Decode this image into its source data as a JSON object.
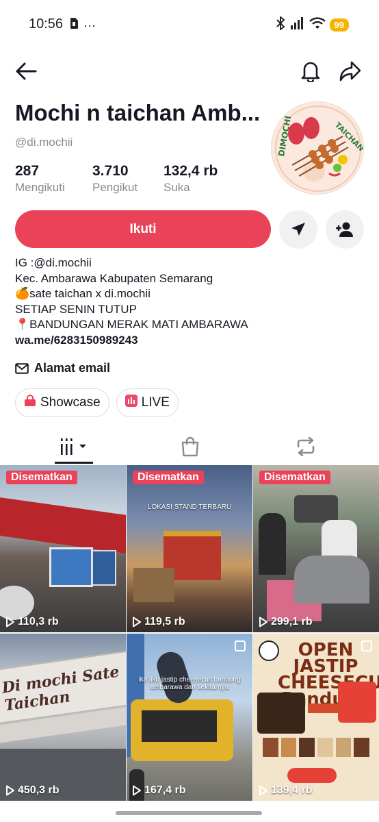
{
  "status_bar": {
    "time": "10:56",
    "battery": "99"
  },
  "profile": {
    "name": "Mochi n taichan Amb...",
    "handle": "@di.mochii",
    "avatar_logo_text": "TAICHAN GAUL DIMOCHI",
    "stats": [
      {
        "value": "287",
        "label": "Mengikuti"
      },
      {
        "value": "3.710",
        "label": "Pengikut"
      },
      {
        "value": "132,4 rb",
        "label": "Suka"
      }
    ],
    "follow_label": "Ikuti",
    "bio_lines": [
      "IG :@di.mochii",
      "Kec. Ambarawa Kabupaten Semarang",
      "🍊sate taichan x di.mochii",
      "SETIAP SENIN TUTUP",
      "📍BANDUNGAN MERAK MATI AMBARAWA"
    ],
    "bio_link": "wa.me/6283150989243",
    "email_label": "Alamat email",
    "chips": [
      {
        "label": "Showcase",
        "color": "#ea4359"
      },
      {
        "label": "LIVE",
        "color": "#e84a6e"
      }
    ]
  },
  "colors": {
    "accent": "#ea4359"
  },
  "videos": [
    {
      "pinned": "Disematkan",
      "views": "110,3 rb",
      "caption": ""
    },
    {
      "pinned": "Disematkan",
      "views": "119,5 rb",
      "caption": "LOKASI STAND TERBARU"
    },
    {
      "pinned": "Disematkan",
      "views": "299,1 rb",
      "caption": ""
    },
    {
      "pinned": "",
      "views": "450,3 rb",
      "caption": "Di mochi Sate Taichan"
    },
    {
      "pinned": "",
      "views": "167,4 rb",
      "caption": "ika liku jastip cheesecuit bandung ambarawa dan sekitarnya"
    },
    {
      "pinned": "",
      "views": "139,4 rb",
      "caption": "OPEN JASTIP CHEESECUIT Bandung"
    }
  ]
}
